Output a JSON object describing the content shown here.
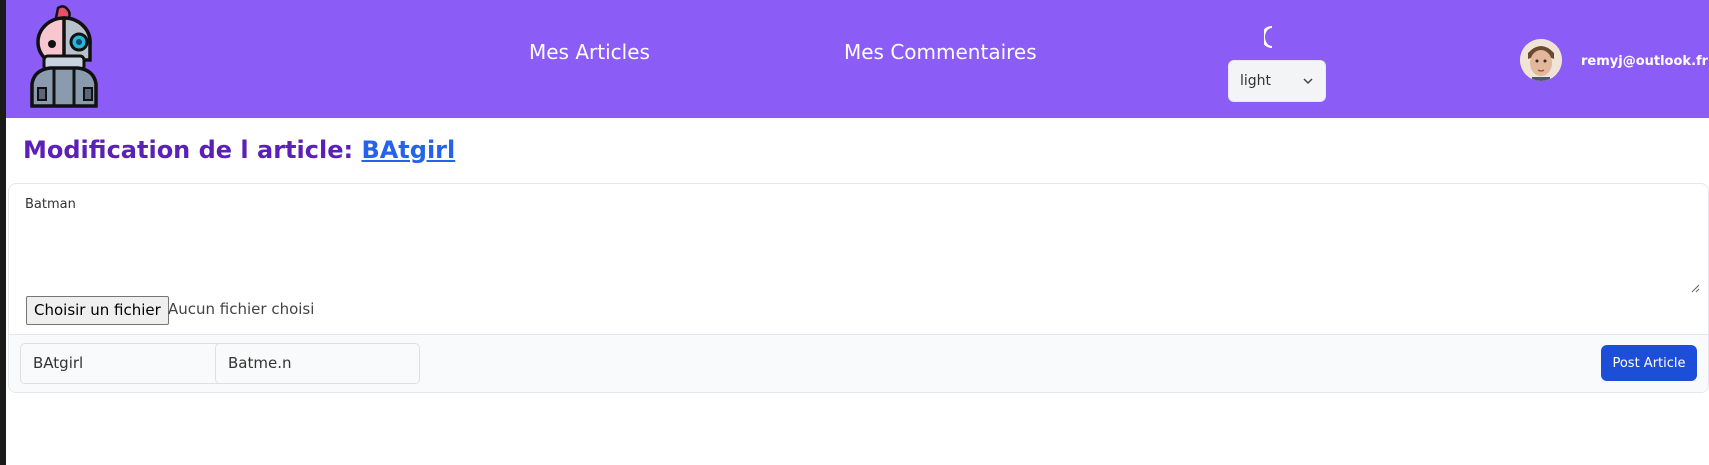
{
  "nav": {
    "links": [
      {
        "label": "Mes Articles"
      },
      {
        "label": "Mes Commentaires"
      }
    ],
    "theme_icon": "moon-icon",
    "theme_select_value": "light",
    "user_email": "remyj@outlook.fr",
    "logo_icon": "robot-logo-icon",
    "brand_color": "#8b5cf6"
  },
  "page": {
    "title_prefix": "Modification de l article: ",
    "article_link": "BAtgirl"
  },
  "form": {
    "content_value": "Batman",
    "file_button_label": "Choisir un fichier",
    "file_status": "Aucun fichier choisi",
    "title_field_value": "BAtgirl",
    "second_field_value": "Batme.n",
    "post_button_label": "Post Article"
  },
  "colors": {
    "title": "#5b21b6",
    "link": "#2563eb",
    "button": "#1d4ed8"
  }
}
